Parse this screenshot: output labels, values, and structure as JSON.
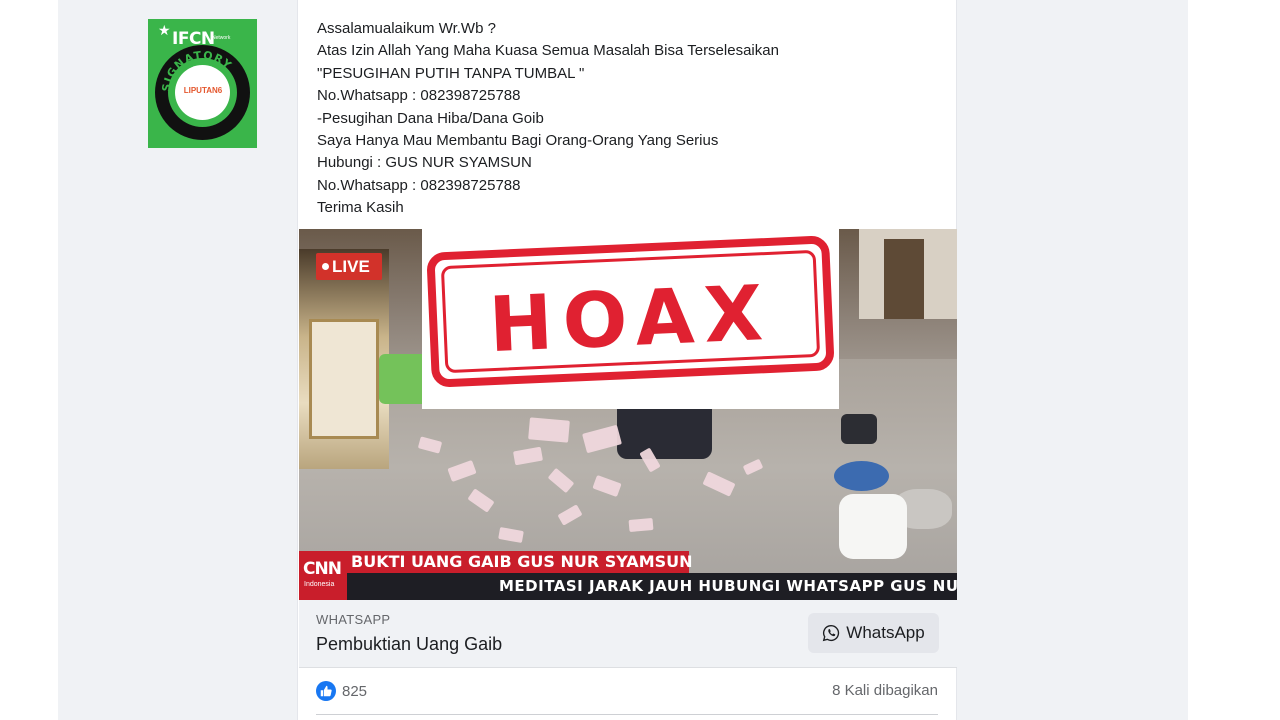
{
  "badge": {
    "title": "IFCN",
    "subtitle": "Network",
    "ring_text": "SIGNATORY",
    "inner_logo": "LIPUTAN6"
  },
  "post": {
    "lines": [
      "Assalamualaikum Wr.Wb ?",
      "Atas Izin Allah Yang Maha Kuasa Semua Masalah Bisa Terselesaikan",
      "\"PESUGIHAN PUTIH TANPA TUMBAL \"",
      "No.Whatsapp : 082398725788",
      "-Pesugihan Dana Hiba/Dana Goib",
      "Saya Hanya Mau Membantu Bagi Orang-Orang Yang Serius",
      "Hubungi : GUS NUR SYAMSUN",
      "No.Whatsapp : 082398725788",
      "Terima Kasih"
    ]
  },
  "media": {
    "live_label": "LIVE",
    "stamp_text": "HOAX",
    "ticker_headline": "BUKTI UANG GAIB GUS NUR SYAMSUN",
    "ticker_sub": "MEDITASI JARAK JAUH HUBUNGI WHATSAPP GUS NUR",
    "channel_logo": "CNN",
    "channel_sub": "Indonesia"
  },
  "link": {
    "domain": "WHATSAPP",
    "title": "Pembuktian Uang Gaib",
    "button_label": "WhatsApp"
  },
  "reactions": {
    "like_count": "825",
    "shares": "8 Kali dibagikan"
  },
  "colors": {
    "stamp_red": "#e02131",
    "badge_green": "#3ab54a",
    "like_blue": "#1877f2",
    "cnn_red": "#c91e2b"
  }
}
